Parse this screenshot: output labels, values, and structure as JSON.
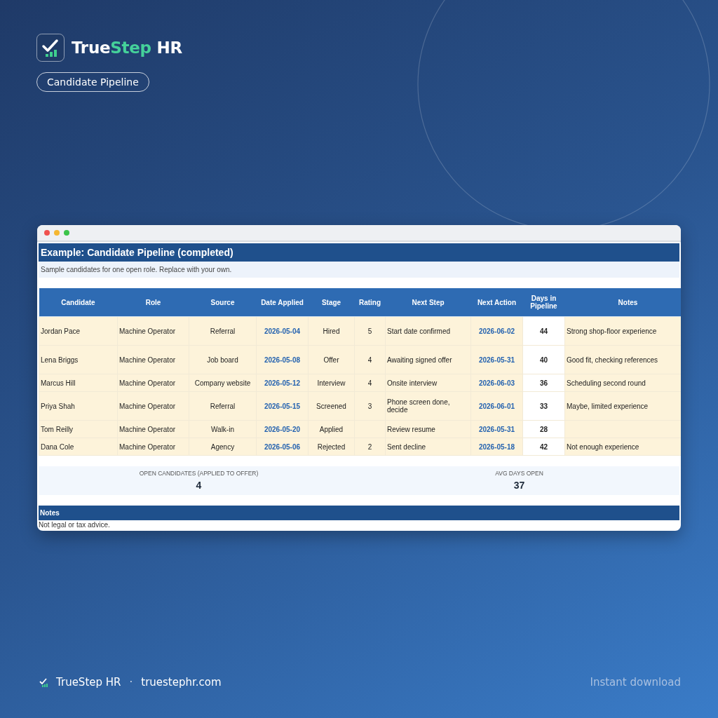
{
  "brand": {
    "name_start": "True",
    "name_accent": "Step",
    "name_end": "HR"
  },
  "badge": "Candidate Pipeline",
  "sheet": {
    "title": "Example: Candidate Pipeline (completed)",
    "subtitle": "Sample candidates for one open role. Replace with your own.",
    "columns": [
      {
        "label": "Candidate",
        "kind": "name"
      },
      {
        "label": "Role",
        "kind": "text"
      },
      {
        "label": "Source",
        "kind": "center"
      },
      {
        "label": "Date Applied",
        "kind": "date"
      },
      {
        "label": "Stage",
        "kind": "center"
      },
      {
        "label": "Rating",
        "kind": "center"
      },
      {
        "label": "Next Step",
        "kind": "text"
      },
      {
        "label": "Next Action",
        "kind": "date"
      },
      {
        "label": "Days in Pipeline",
        "kind": "number"
      },
      {
        "label": "Notes",
        "kind": "text"
      }
    ],
    "rows": [
      [
        "Jordan Pace",
        "Machine Operator",
        "Referral",
        "2026-05-04",
        "Hired",
        "5",
        "Start date confirmed",
        "2026-06-02",
        "44",
        "Strong shop-floor experience"
      ],
      [
        "Lena Briggs",
        "Machine Operator",
        "Job board",
        "2026-05-08",
        "Offer",
        "4",
        "Awaiting signed offer",
        "2026-05-31",
        "40",
        "Good fit, checking references"
      ],
      [
        "Marcus Hill",
        "Machine Operator",
        "Company website",
        "2026-05-12",
        "Interview",
        "4",
        "Onsite interview",
        "2026-06-03",
        "36",
        "Scheduling second round"
      ],
      [
        "Priya Shah",
        "Machine Operator",
        "Referral",
        "2026-05-15",
        "Screened",
        "3",
        "Phone screen done, decide",
        "2026-06-01",
        "33",
        "Maybe, limited experience"
      ],
      [
        "Tom Reilly",
        "Machine Operator",
        "Walk-in",
        "2026-05-20",
        "Applied",
        "",
        "Review resume",
        "2026-05-31",
        "28",
        ""
      ],
      [
        "Dana Cole",
        "Machine Operator",
        "Agency",
        "2026-05-06",
        "Rejected",
        "2",
        "Sent decline",
        "2026-05-18",
        "42",
        "Not enough experience"
      ]
    ],
    "summary": [
      {
        "label": "OPEN CANDIDATES (APPLIED TO OFFER)",
        "value": "4"
      },
      {
        "label": "AVG DAYS OPEN",
        "value": "37"
      }
    ],
    "notes_title": "Notes",
    "notes_text": "Not legal or tax advice."
  },
  "footer": {
    "brand": "TrueStep HR",
    "separator": "·",
    "site": "truestephr.com",
    "cta": "Instant download"
  }
}
